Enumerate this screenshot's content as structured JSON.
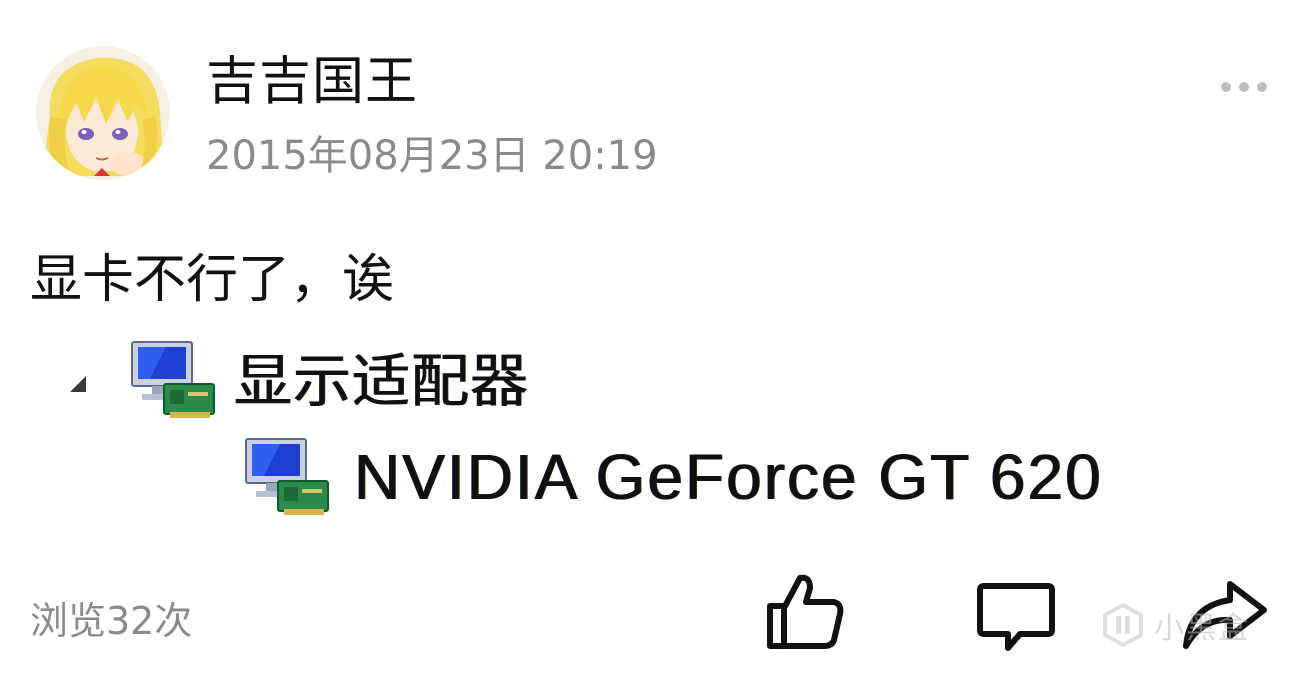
{
  "post": {
    "author": {
      "name": "吉吉国王",
      "avatar_icon": "anime-girl-avatar"
    },
    "timestamp": "2015年08月23日 20:19",
    "more_icon": "more-dots-icon",
    "text": "显卡不行了，诶",
    "image": {
      "tree": {
        "category_label": "显示适配器",
        "device_label": "NVIDIA GeForce GT 620",
        "expanded": true,
        "icon": "display-adapter-icon"
      }
    },
    "footer": {
      "view_count": "浏览32次",
      "like_icon": "thumbs-up-icon",
      "comment_icon": "comment-icon",
      "share_icon": "share-icon"
    },
    "watermark": {
      "text": "小黑盒",
      "icon": "xiaoheihe-logo-icon"
    }
  },
  "colors": {
    "primary_text": "#111111",
    "secondary_text": "#8a8a8a",
    "more_dots": "#bdbdbd",
    "icon_stroke": "#111111"
  }
}
